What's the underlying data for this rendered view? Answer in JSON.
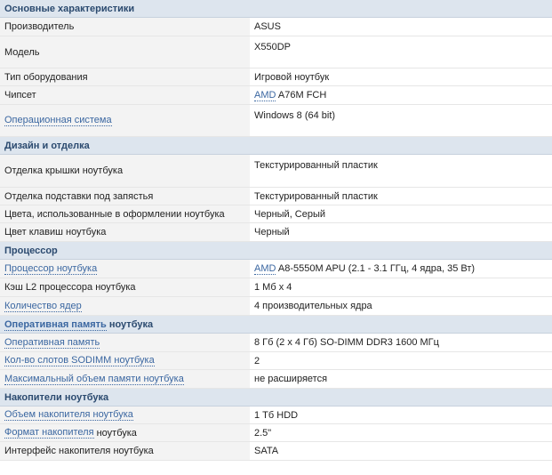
{
  "sections": {
    "main": {
      "title": "Основные характеристики",
      "manufacturer_label": "Производитель",
      "manufacturer_value": "ASUS",
      "model_label": "Модель",
      "model_value": "X550DP",
      "type_label": "Тип оборудования",
      "type_value": "Игровой ноутбук",
      "chipset_label": "Чипсет",
      "chipset_brand": "AMD",
      "chipset_value": " A76M FCH",
      "os_label": "Операционная система",
      "os_value": "Windows 8 (64 bit)"
    },
    "design": {
      "title": "Дизайн и отделка",
      "lid_label": "Отделка крышки ноутбука",
      "lid_value": "Текстурированный пластик",
      "palmrest_label": "Отделка подставки под запястья",
      "palmrest_value": "Текстурированный пластик",
      "colors_label": "Цвета, использованные в оформлении ноутбука",
      "colors_value": "Черный, Серый",
      "keys_label": "Цвет клавиш ноутбука",
      "keys_value": "Черный"
    },
    "cpu": {
      "title": "Процессор",
      "cpu_label": "Процессор ноутбука",
      "cpu_brand": "AMD",
      "cpu_value": " A8-5550M APU (2.1 - 3.1 ГГц, 4 ядра, 35 Вт)",
      "l2_label": "Кэш L2 процессора ноутбука",
      "l2_value": "1 Мб x 4",
      "cores_label": "Количество ядер",
      "cores_value": "4 производительных ядра"
    },
    "ram": {
      "title_link": "Оперативная память",
      "title_rest": " ноутбука",
      "ram_label": "Оперативная память",
      "ram_value": "8 Гб (2 x 4 Гб) SO-DIMM DDR3 1600 МГц",
      "slots_label": "Кол-во слотов SODIMM ноутбука",
      "slots_value": "2",
      "max_label": "Максимальный объем памяти ноутбука",
      "max_value": "не расширяется"
    },
    "storage": {
      "title": "Накопители ноутбука",
      "volume_label": "Объем накопителя ноутбука",
      "volume_value": "1 Тб HDD",
      "format_label_link": "Формат накопителя",
      "format_label_rest": " ноутбука",
      "format_value": "2.5\"",
      "interface_label": "Интерфейс накопителя ноутбука",
      "interface_value": "SATA"
    }
  }
}
